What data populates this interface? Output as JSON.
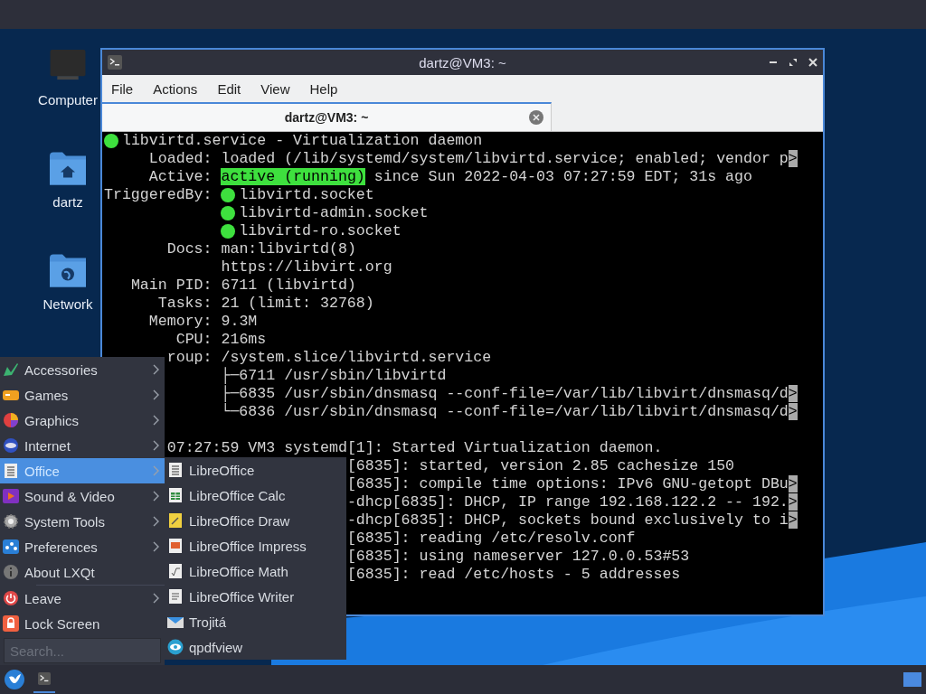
{
  "desktop": {
    "icons": [
      {
        "label": "Computer"
      },
      {
        "label": "dartz"
      },
      {
        "label": "Network"
      }
    ]
  },
  "window": {
    "title": "dartz@VM3: ~",
    "menu": [
      "File",
      "Actions",
      "Edit",
      "View",
      "Help"
    ],
    "tabs": [
      {
        "label": "dartz@VM3: ~",
        "selected": true
      }
    ],
    "terminal": {
      "lines": [
        [
          {
            "kind": "dot",
            "color": "#3ee03e"
          },
          {
            "kind": "text",
            "text": " libvirtd.service - Virtualization daemon"
          }
        ],
        [
          {
            "kind": "text",
            "text": "     Loaded: loaded (/lib/systemd/system/libvirtd.service; enabled; vendor p"
          },
          {
            "kind": "more",
            "text": ">"
          }
        ],
        [
          {
            "kind": "text",
            "text": "     Active: "
          },
          {
            "kind": "highlight",
            "text": "active (running)"
          },
          {
            "kind": "text",
            "text": " since Sun 2022-04-03 07:27:59 EDT; 31s ago"
          }
        ],
        [
          {
            "kind": "text",
            "text": "TriggeredBy: "
          },
          {
            "kind": "dot",
            "color": "#3ee03e"
          },
          {
            "kind": "text",
            "text": " libvirtd.socket"
          }
        ],
        [
          {
            "kind": "gap"
          },
          {
            "kind": "dot",
            "color": "#3ee03e"
          },
          {
            "kind": "text",
            "text": " libvirtd-admin.socket"
          }
        ],
        [
          {
            "kind": "gap"
          },
          {
            "kind": "dot",
            "color": "#3ee03e"
          },
          {
            "kind": "text",
            "text": " libvirtd-ro.socket"
          }
        ],
        [
          {
            "kind": "text",
            "text": "       Docs: man:libvirtd(8)"
          }
        ],
        [
          {
            "kind": "text",
            "text": "             https://libvirt.org"
          }
        ],
        [
          {
            "kind": "text",
            "text": "   Main PID: 6711 (libvirtd)"
          }
        ],
        [
          {
            "kind": "text",
            "text": "      Tasks: 21 (limit: 32768)"
          }
        ],
        [
          {
            "kind": "text",
            "text": "     Memory: 9.3M"
          }
        ],
        [
          {
            "kind": "text",
            "text": "        CPU: 216ms"
          }
        ],
        [
          {
            "kind": "text",
            "text": "       roup: /system.slice/libvirtd.service"
          }
        ],
        [
          {
            "kind": "text",
            "text": "             ├─6711 /usr/sbin/libvirtd"
          }
        ],
        [
          {
            "kind": "text",
            "text": "             ├─6835 /usr/sbin/dnsmasq --conf-file=/var/lib/libvirt/dnsmasq/d"
          },
          {
            "kind": "more",
            "text": ">"
          }
        ],
        [
          {
            "kind": "text",
            "text": "             └─6836 /usr/sbin/dnsmasq --conf-file=/var/lib/libvirt/dnsmasq/d"
          },
          {
            "kind": "more",
            "text": ">"
          }
        ],
        [
          {
            "kind": "blank-line"
          },
          {
            "kind": "text",
            "text": "       07:27:59 VM3 systemd[1]: Started Virtualization daemon."
          }
        ],
        [
          {
            "kind": "text",
            "text": "                           [6835]: started, version 2.85 cachesize 150"
          }
        ],
        [
          {
            "kind": "text",
            "text": "                           [6835]: compile time options: IPv6 GNU-getopt DBu"
          },
          {
            "kind": "more",
            "text": ">"
          }
        ],
        [
          {
            "kind": "text",
            "text": "                           -dhcp[6835]: DHCP, IP range 192.168.122.2 -- 192."
          },
          {
            "kind": "more",
            "text": ">"
          }
        ],
        [
          {
            "kind": "text",
            "text": "                           -dhcp[6835]: DHCP, sockets bound exclusively to i"
          },
          {
            "kind": "more",
            "text": ">"
          }
        ],
        [
          {
            "kind": "text",
            "text": "                           [6835]: reading /etc/resolv.conf"
          }
        ],
        [
          {
            "kind": "text",
            "text": "                           [6835]: using nameserver 127.0.0.53#53"
          }
        ],
        [
          {
            "kind": "text",
            "text": "                           [6835]: read /etc/hosts - 5 addresses"
          }
        ]
      ]
    }
  },
  "start_menu": {
    "items": [
      {
        "kind": "item",
        "label": "Accessories",
        "submenu": true,
        "selected": false
      },
      {
        "kind": "item",
        "label": "Games",
        "submenu": true,
        "selected": false
      },
      {
        "kind": "item",
        "label": "Graphics",
        "submenu": true,
        "selected": false
      },
      {
        "kind": "item",
        "label": "Internet",
        "submenu": true,
        "selected": false
      },
      {
        "kind": "item",
        "label": "Office",
        "submenu": true,
        "selected": true
      },
      {
        "kind": "item",
        "label": "Sound & Video",
        "submenu": true,
        "selected": false
      },
      {
        "kind": "item",
        "label": "System Tools",
        "submenu": true,
        "selected": false
      },
      {
        "kind": "item",
        "label": "Preferences",
        "submenu": true,
        "selected": false
      },
      {
        "kind": "item",
        "label": "About LXQt",
        "submenu": false,
        "selected": false
      },
      {
        "kind": "separator"
      },
      {
        "kind": "item",
        "label": "Leave",
        "submenu": true,
        "selected": false
      },
      {
        "kind": "item",
        "label": "Lock Screen",
        "submenu": false,
        "selected": false
      }
    ],
    "search": {
      "placeholder": "Search..."
    }
  },
  "submenu": {
    "items": [
      "LibreOffice",
      "LibreOffice Calc",
      "LibreOffice Draw",
      "LibreOffice Impress",
      "LibreOffice Math",
      "LibreOffice Writer",
      "Trojitá",
      "qpdfview"
    ]
  },
  "taskbar": {
    "tasks": [
      {
        "active": true
      }
    ]
  }
}
